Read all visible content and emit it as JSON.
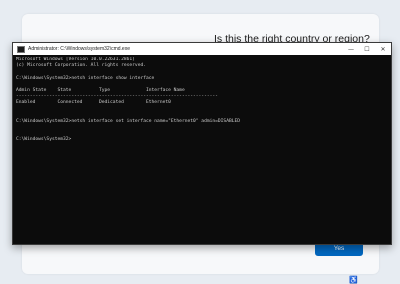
{
  "oobe": {
    "question": "Is this the right country or region?",
    "yes_label": "Yes",
    "accessibility_icon": "accessibility-icon"
  },
  "cmd": {
    "title": "Administrator: C:\\Windows\\system32\\cmd.exe",
    "controls": {
      "minimize": "—",
      "maximize": "☐",
      "close": "✕"
    },
    "lines": [
      "Microsoft Windows [Version 10.0.22631.2861]",
      "(c) Microsoft Corporation. All rights reserved.",
      "",
      "C:\\Windows\\System32>netsh interface show interface",
      "",
      "Admin State    State          Type             Interface Name",
      "-------------------------------------------------------------------------",
      "Enabled        Connected      Dedicated        Ethernet0",
      "",
      "",
      "C:\\Windows\\System32>netsh interface set interface name=\"Ethernet0\" admin=DISABLED",
      "",
      "",
      "C:\\Windows\\System32>"
    ]
  }
}
